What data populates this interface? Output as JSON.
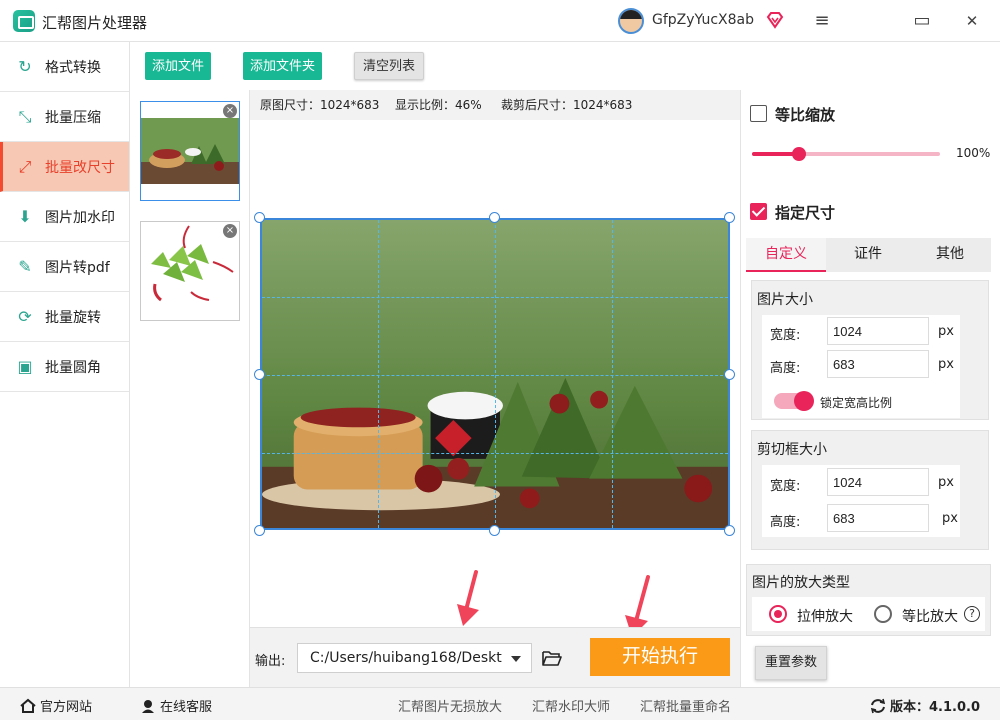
{
  "app": {
    "title": "汇帮图片处理器",
    "username": "GfpZyYucX8ab"
  },
  "icons": {
    "logo": "image-app-icon",
    "avatar": "user-avatar",
    "vip": "diamond-icon",
    "menu": "hamburger-icon",
    "maximize": "window-maximize-icon",
    "close": "close-icon",
    "folder": "folder-open-icon",
    "home": "home-icon",
    "service": "customer-service-icon",
    "refresh": "refresh-icon"
  },
  "window_buttons": {
    "menu": "≡",
    "maximize": "▭",
    "close": "✕"
  },
  "sidebar": {
    "items": [
      {
        "label": "格式转换",
        "icon": "↻"
      },
      {
        "label": "批量压缩",
        "icon": "⤡"
      },
      {
        "label": "批量改尺寸",
        "icon": "⤢"
      },
      {
        "label": "图片加水印",
        "icon": "⬇"
      },
      {
        "label": "图片转pdf",
        "icon": "✎"
      },
      {
        "label": "批量旋转",
        "icon": "⟳"
      },
      {
        "label": "批量圆角",
        "icon": "▣"
      }
    ],
    "active_index": 2
  },
  "toolbar": {
    "add_file": "添加文件",
    "add_folder": "添加文件夹",
    "clear_list": "清空列表"
  },
  "thumbnails": {
    "close_glyph": "×"
  },
  "info_bar": {
    "original_size": "原图尺寸：1024*683",
    "display_ratio": "显示比例：46%",
    "cropped_size": "裁剪后尺寸：1024*683"
  },
  "output": {
    "label": "输出:",
    "path": "C:/Users/huibang168/Deskt",
    "start_button": "开始执行"
  },
  "right_panel": {
    "proportional_scale": {
      "label": "等比缩放",
      "checked": false,
      "value_text": "100%",
      "value_fraction": 0.25
    },
    "specify_size": {
      "label": "指定尺寸",
      "checked": true
    },
    "tabs": [
      "自定义",
      "证件",
      "其他"
    ],
    "active_tab": 0,
    "image_size": {
      "title": "图片大小",
      "width_label": "宽度:",
      "width_value": "1024",
      "height_label": "高度:",
      "height_value": "683",
      "unit": "px",
      "lock_label": "锁定宽高比例"
    },
    "crop_size": {
      "title": "剪切框大小",
      "width_label": "宽度:",
      "width_value": "1024",
      "height_label": "高度:",
      "height_value": "683",
      "unit": "px"
    },
    "enlarge_type": {
      "title": "图片的放大类型",
      "option_stretch": "拉伸放大",
      "option_proportional": "等比放大",
      "selected": "拉伸放大",
      "help": "?"
    },
    "reset_button": "重置参数"
  },
  "footer": {
    "official_site": "官方网站",
    "online_service": "在线客服",
    "links": [
      "汇帮图片无损放大",
      "汇帮水印大师",
      "汇帮批量重命名"
    ],
    "version": "版本：4.1.0.0"
  },
  "colors": {
    "accent": "#e8245a",
    "green": "#18b894",
    "orange": "#fb9a16",
    "active_side": "#f7c9b5",
    "arrow": "#f0445a"
  }
}
